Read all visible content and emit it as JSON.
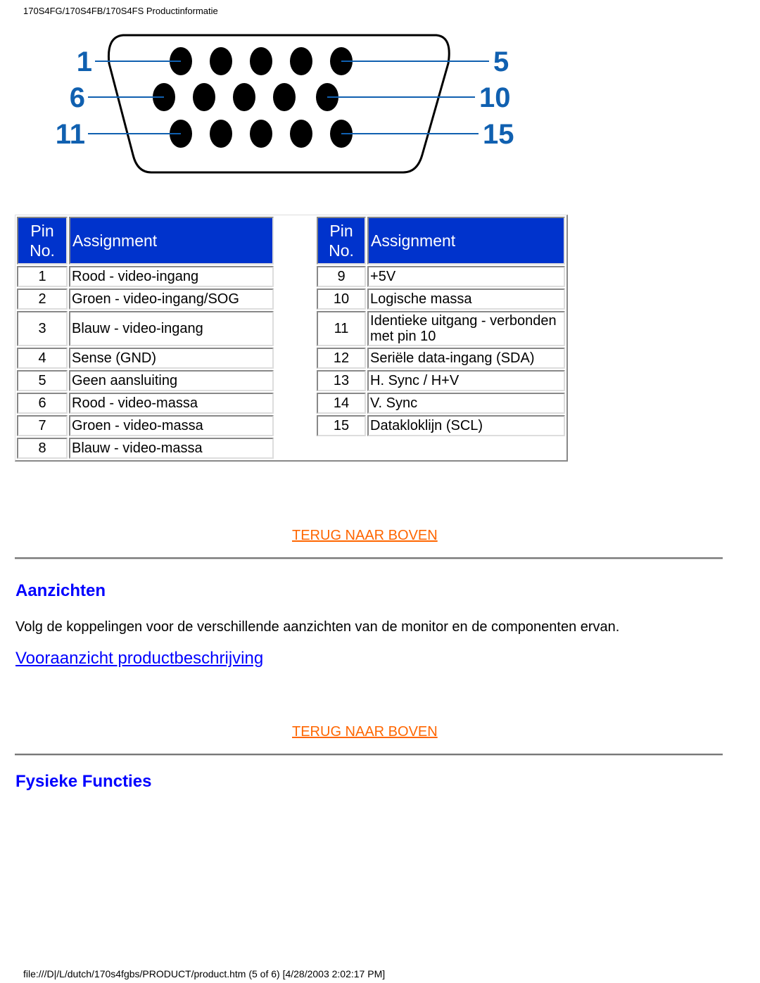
{
  "page_header": "170S4FG/170S4FB/170S4FS Productinformatie",
  "connector_diagram": {
    "label_color": "#1060b0",
    "labels": [
      "1",
      "5",
      "6",
      "10",
      "11",
      "15"
    ],
    "rows": [
      5,
      5,
      5
    ]
  },
  "pin_table": {
    "header_bg": "#0033cc",
    "headers": {
      "pin": [
        "Pin",
        "No."
      ],
      "assignment": "Assignment"
    },
    "left": [
      {
        "pin": "1",
        "assignment": "Rood - video-ingang"
      },
      {
        "pin": "2",
        "assignment": "Groen - video-ingang/SOG"
      },
      {
        "pin": "3",
        "assignment": "Blauw - video-ingang"
      },
      {
        "pin": "4",
        "assignment": "Sense (GND)"
      },
      {
        "pin": "5",
        "assignment": "Geen aansluiting"
      },
      {
        "pin": "6",
        "assignment": "Rood - video-massa"
      },
      {
        "pin": "7",
        "assignment": "Groen - video-massa"
      },
      {
        "pin": "8",
        "assignment": "Blauw - video-massa"
      }
    ],
    "right": [
      {
        "pin": "9",
        "assignment": "+5V"
      },
      {
        "pin": "10",
        "assignment": "Logische massa"
      },
      {
        "pin": "11",
        "assignment": "Identieke uitgang - verbonden met pin 10"
      },
      {
        "pin": "12",
        "assignment": "Seriële data-ingang (SDA)"
      },
      {
        "pin": "13",
        "assignment": "H. Sync / H+V"
      },
      {
        "pin": "14",
        "assignment": "V. Sync"
      },
      {
        "pin": "15",
        "assignment": "Datakloklijn (SCL)"
      }
    ]
  },
  "back_to_top_label": "TERUG NAAR BOVEN",
  "sections": {
    "aanzichten": {
      "title": "Aanzichten",
      "text": "Volg de koppelingen voor de verschillende aanzichten van de monitor en de componenten ervan.",
      "link": "Vooraanzicht productbeschrijving"
    },
    "fysieke": {
      "title": "Fysieke Functies"
    }
  },
  "colors": {
    "link": "#0000ff",
    "back_to_top": "#ff6600",
    "heading": "#0000ff"
  },
  "footer": "file:///D|/L/dutch/170s4fgbs/PRODUCT/product.htm (5 of 6) [4/28/2003 2:02:17 PM]"
}
